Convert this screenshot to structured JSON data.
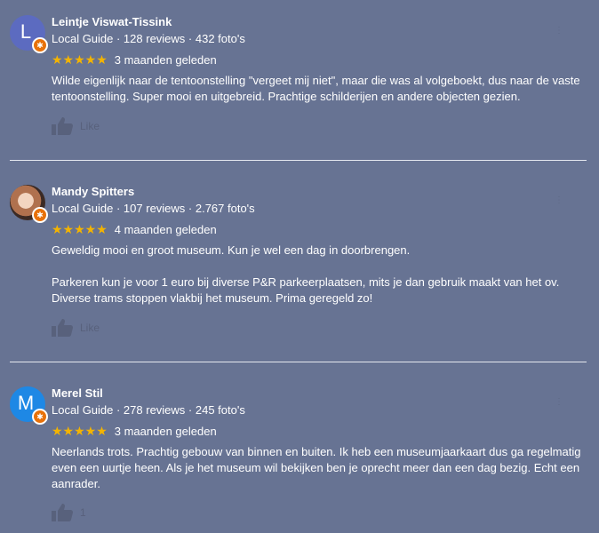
{
  "reviews": [
    {
      "avatar_letter": "L",
      "avatar_color": "#5c6bc0",
      "name": "Leintje Viswat-Tissink",
      "meta": "Local Guide · 128 reviews · 432 foto's",
      "stars": "★★★★★",
      "time": "3 maanden geleden",
      "paragraphs": [
        "Wilde eigenlijk naar de tentoonstelling \"vergeet mij niet\", maar die was al volgeboekt, dus naar de vaste tentoonstelling. Super mooi en uitgebreid. Prachtige schilderijen en andere objecten gezien."
      ],
      "like_label": "Like"
    },
    {
      "avatar_letter": "",
      "avatar_color": "#b0714e",
      "name": "Mandy Spitters",
      "meta": "Local Guide · 107 reviews · 2.767 foto's",
      "stars": "★★★★★",
      "time": "4 maanden geleden",
      "paragraphs": [
        "Geweldig mooi en groot  museum. Kun je wel een dag in doorbrengen.",
        "Parkeren kun je voor 1 euro bij diverse P&R parkeerplaatsen, mits je dan gebruik maakt van het ov. Diverse trams stoppen vlakbij het museum. Prima geregeld zo!"
      ],
      "like_label": "Like"
    },
    {
      "avatar_letter": "M",
      "avatar_color": "#1e88e5",
      "name": "Merel Stil",
      "meta": "Local Guide · 278 reviews · 245 foto's",
      "stars": "★★★★★",
      "time": "3 maanden geleden",
      "paragraphs": [
        "Neerlands trots. Prachtig gebouw van binnen en buiten. Ik heb een museumjaarkaart dus ga regelmatig even een uurtje heen. Als je het museum wil bekijken ben je oprecht meer dan een dag bezig. Echt een aanrader."
      ],
      "like_label": "1"
    }
  ],
  "badge_glyph": "✱",
  "menu_glyph": "⋮",
  "icons": {
    "like": "thumbs-up-icon",
    "badge": "local-guide-badge-icon",
    "menu": "more-options-icon"
  }
}
